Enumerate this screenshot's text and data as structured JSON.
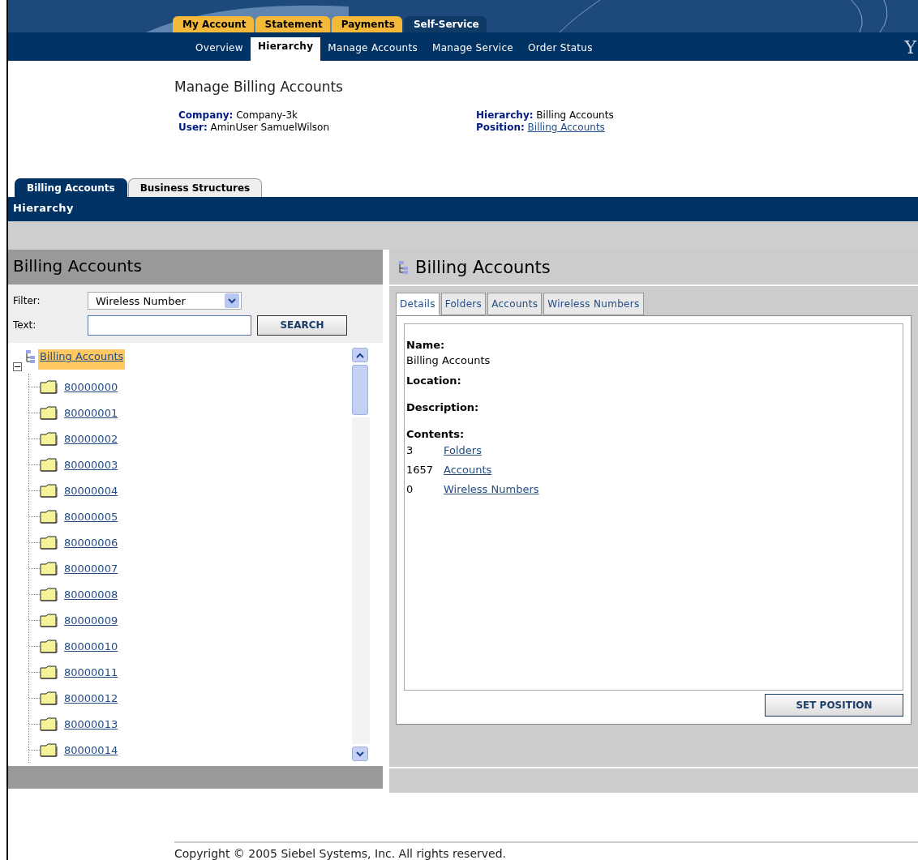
{
  "header": {
    "top_tabs": [
      {
        "label": "My Account",
        "selected": false
      },
      {
        "label": "Statement",
        "selected": false
      },
      {
        "label": "Payments",
        "selected": false
      },
      {
        "label": "Self-Service",
        "selected": true
      }
    ],
    "nav": [
      {
        "label": "Overview",
        "selected": false
      },
      {
        "label": "Hierarchy",
        "selected": true
      },
      {
        "label": "Manage Accounts",
        "selected": false
      },
      {
        "label": "Manage Service",
        "selected": false
      },
      {
        "label": "Order Status",
        "selected": false
      }
    ],
    "logo_fragment": "Y"
  },
  "page": {
    "title": "Manage Billing Accounts",
    "info": [
      {
        "label": "Company:",
        "value": "Company-3k",
        "kind": "text"
      },
      {
        "label": "Hierarchy:",
        "value": "Billing Accounts",
        "kind": "text"
      },
      {
        "label": "User:",
        "value": "AminUser SamuelWilson",
        "kind": "text"
      },
      {
        "label": "Position:",
        "value": "Billing Accounts",
        "kind": "link"
      }
    ]
  },
  "section_tabs": [
    {
      "label": "Billing Accounts",
      "selected": true
    },
    {
      "label": "Business Structures",
      "selected": false
    }
  ],
  "section_bar": "Hierarchy",
  "left_panel": {
    "title": "Billing Accounts",
    "filter": {
      "label": "Filter:",
      "value": "Wireless Number"
    },
    "text": {
      "label": "Text:"
    },
    "search_button": "SEARCH",
    "tree": {
      "label": "Billing Accounts",
      "selected": true,
      "expanded": true,
      "children": [
        {
          "label": "80000000"
        },
        {
          "label": "80000001"
        },
        {
          "label": "80000002"
        },
        {
          "label": "80000003"
        },
        {
          "label": "80000004"
        },
        {
          "label": "80000005"
        },
        {
          "label": "80000006"
        },
        {
          "label": "80000007"
        },
        {
          "label": "80000008"
        },
        {
          "label": "80000009"
        },
        {
          "label": "80000010"
        },
        {
          "label": "80000011"
        },
        {
          "label": "80000012"
        },
        {
          "label": "80000013"
        },
        {
          "label": "80000014"
        }
      ]
    }
  },
  "right_panel": {
    "title": "Billing Accounts",
    "tabs": [
      {
        "label": "Details",
        "selected": true
      },
      {
        "label": "Folders",
        "selected": false
      },
      {
        "label": "Accounts",
        "selected": false
      },
      {
        "label": "Wireless Numbers",
        "selected": false
      }
    ],
    "fields": [
      {
        "label": "Name:",
        "value": "Billing Accounts"
      },
      {
        "label": "Location:"
      },
      {
        "label": "Description:"
      },
      {
        "label": "Contents:"
      }
    ],
    "contents": [
      {
        "count": "3",
        "link": "Folders"
      },
      {
        "count": "1657",
        "link": "Accounts"
      },
      {
        "count": "0",
        "link": "Wireless Numbers"
      }
    ],
    "button": "SET POSITION"
  },
  "footer": "Copyright © 2005 Siebel Systems, Inc. All rights reserved."
}
